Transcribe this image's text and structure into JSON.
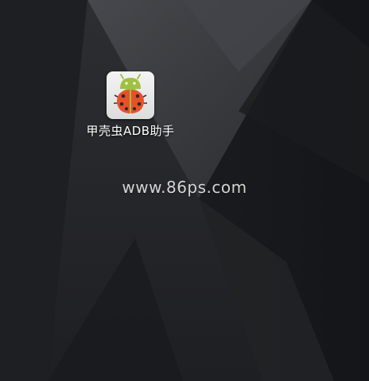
{
  "desktop": {
    "shortcuts": [
      {
        "label": "甲壳虫ADB助手",
        "icon": "ladybug-android-icon"
      }
    ]
  },
  "watermark": {
    "text": "www.86ps.com"
  },
  "colors": {
    "wallpaper_base": "#1c1d20",
    "wallpaper_light_facet": "#3a3b3f",
    "icon_background": "#e8e8e8",
    "ladybug_shell": "#e8502a",
    "android_head": "#9fc142",
    "label_text": "#ffffff"
  }
}
